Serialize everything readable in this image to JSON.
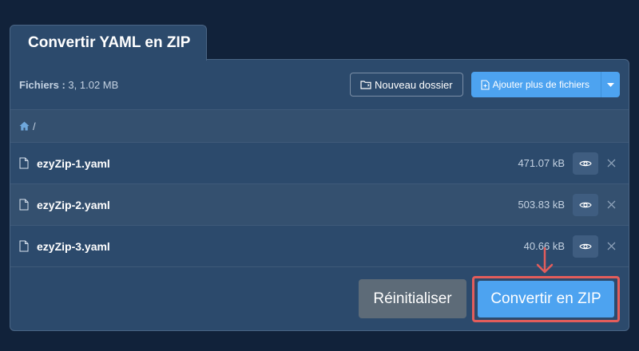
{
  "tab": {
    "title": "Convertir YAML en ZIP"
  },
  "toolbar": {
    "files_label": "Fichiers :",
    "files_value": "3, 1.02 MB",
    "new_folder_label": "Nouveau dossier",
    "add_files_label": "Ajouter plus de fichiers"
  },
  "breadcrumb": {
    "separator": "/"
  },
  "files": [
    {
      "name": "ezyZip-1.yaml",
      "size": "471.07 kB"
    },
    {
      "name": "ezyZip-2.yaml",
      "size": "503.83 kB"
    },
    {
      "name": "ezyZip-3.yaml",
      "size": "40.66 kB"
    }
  ],
  "actions": {
    "reset_label": "Réinitialiser",
    "convert_label": "Convertir en ZIP"
  },
  "colors": {
    "background": "#11223a",
    "panel": "#2c4a6c",
    "accent": "#4da3f0",
    "highlight": "#e35d5b",
    "reset": "#5d6b78"
  }
}
